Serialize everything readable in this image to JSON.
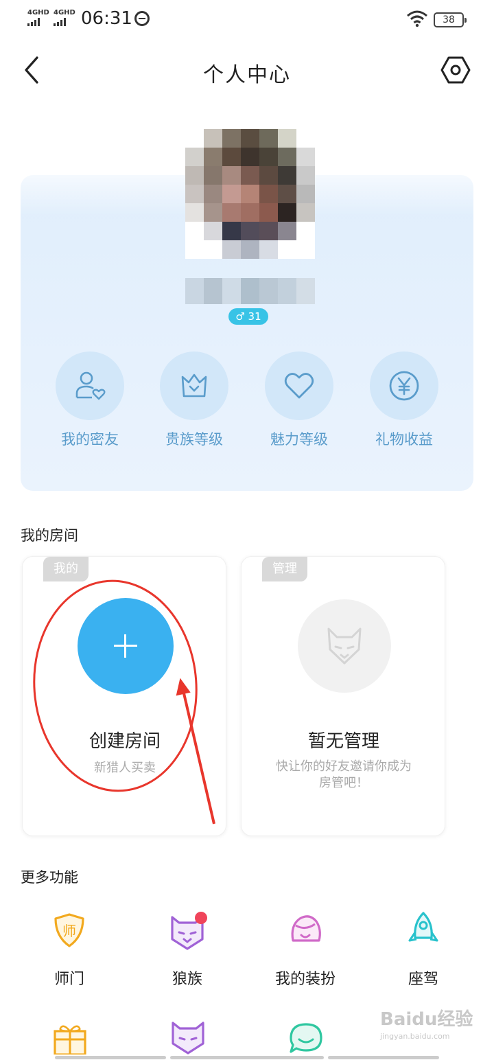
{
  "status_bar": {
    "signal_1": "4GHD",
    "signal_2": "4GHD",
    "time": "06:31",
    "battery": "38"
  },
  "header": {
    "title": "个人中心",
    "back_icon": "chevron-left-icon",
    "settings_icon": "hexagon-settings-icon"
  },
  "profile": {
    "gender_badge": "♂ 31",
    "quick_actions": [
      {
        "label": "我的密友",
        "icon": "user-heart-icon"
      },
      {
        "label": "贵族等级",
        "icon": "crown-icon"
      },
      {
        "label": "魅力等级",
        "icon": "heart-icon"
      },
      {
        "label": "礼物收益",
        "icon": "yen-circle-icon"
      }
    ]
  },
  "my_rooms": {
    "title": "我的房间",
    "mine": {
      "tag": "我的",
      "title": "创建房间",
      "subtitle": "新猎人买卖"
    },
    "managed": {
      "tag": "管理",
      "title": "暂无管理",
      "subtitle_line1": "快让你的好友邀请你成为",
      "subtitle_line2": "房管吧！"
    }
  },
  "more_functions": {
    "title": "更多功能",
    "items": [
      {
        "label": "师门",
        "icon": "mentor-shield-icon"
      },
      {
        "label": "狼族",
        "icon": "wolf-clan-icon"
      },
      {
        "label": "我的装扮",
        "icon": "dress-up-face-icon"
      },
      {
        "label": "座驾",
        "icon": "rocket-icon"
      }
    ],
    "row2_icons": [
      "gift-icon",
      "wolf-icon",
      "chat-bubble-icon"
    ]
  },
  "watermark": {
    "brand": "Baidu经验",
    "url": "jingyan.baidu.com"
  },
  "colors": {
    "accent_blue": "#3ab1f0",
    "badge_cyan": "#38c3e6",
    "quick_label": "#5a9ccb",
    "annotation_red": "#e8362c"
  }
}
